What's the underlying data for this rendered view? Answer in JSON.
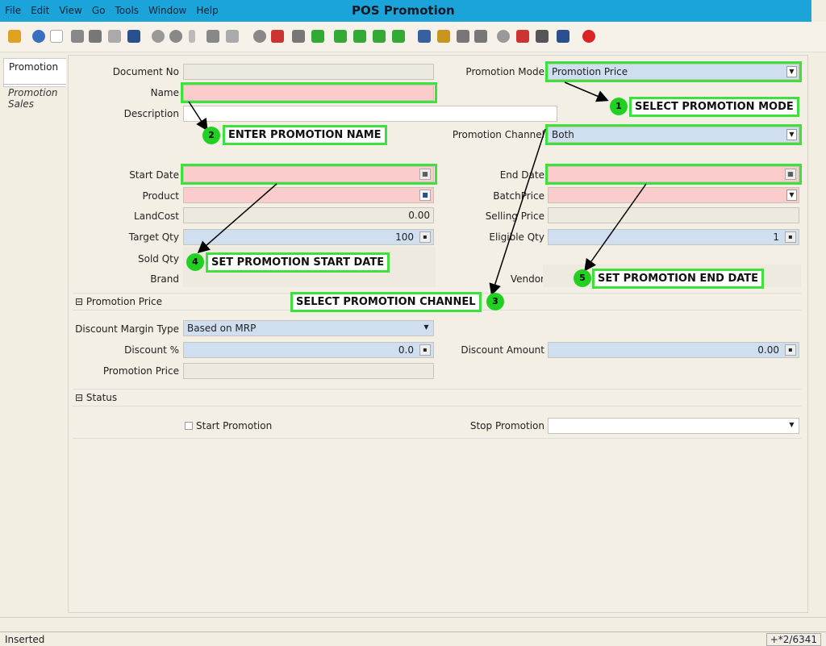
{
  "menu": [
    "File",
    "Edit",
    "View",
    "Go",
    "Tools",
    "Window",
    "Help"
  ],
  "window_title": "POS Promotion",
  "tabs": [
    "Promotion",
    "Promotion Sales"
  ],
  "form": {
    "document_no_label": "Document No",
    "name_label": "Name",
    "description_label": "Description",
    "start_date_label": "Start Date",
    "product_label": "Product",
    "landcost_label": "LandCost",
    "landcost_value": "0.00",
    "target_qty_label": "Target Qty",
    "target_qty_value": "100",
    "sold_qty_label": "Sold Qty",
    "brand_label": "Brand",
    "promotion_mode_label": "Promotion Mode",
    "promotion_mode_value": "Promotion Price",
    "promotion_channel_label": "Promotion Channel",
    "promotion_channel_value": "Both",
    "end_date_label": "End Date",
    "batch_price_label": "BatchPrice",
    "selling_price_label": "Selling Price",
    "eligible_qty_label": "Eligible Qty",
    "eligible_qty_value": "1",
    "vendor_label": "Vendor"
  },
  "promotion_price_section": {
    "title": "Promotion Price",
    "discount_margin_type_label": "Discount Margin Type",
    "discount_margin_type_value": "Based on MRP",
    "discount_pct_label": "Discount %",
    "discount_pct_value": "0.0",
    "discount_amount_label": "Discount Amount",
    "discount_amount_value": "0.00",
    "promotion_price_label": "Promotion Price"
  },
  "status_section": {
    "title": "Status",
    "start_promotion_label": "Start Promotion",
    "stop_promotion_label": "Stop Promotion"
  },
  "callouts": [
    {
      "num": "1",
      "text": "SELECT PROMOTION MODE"
    },
    {
      "num": "2",
      "text": "ENTER PROMOTION NAME"
    },
    {
      "num": "3",
      "text": "SELECT PROMOTION CHANNEL"
    },
    {
      "num": "4",
      "text": "SET PROMOTION START DATE"
    },
    {
      "num": "5",
      "text": "SET PROMOTION END DATE"
    }
  ],
  "statusbar": {
    "left": "Inserted",
    "right": "+*2/6341"
  },
  "colors": {
    "titlebar": "#1ba4da",
    "highlight": "#3ee03e",
    "mandatory": "#fccccc",
    "blue_field": "#cfdff0"
  }
}
